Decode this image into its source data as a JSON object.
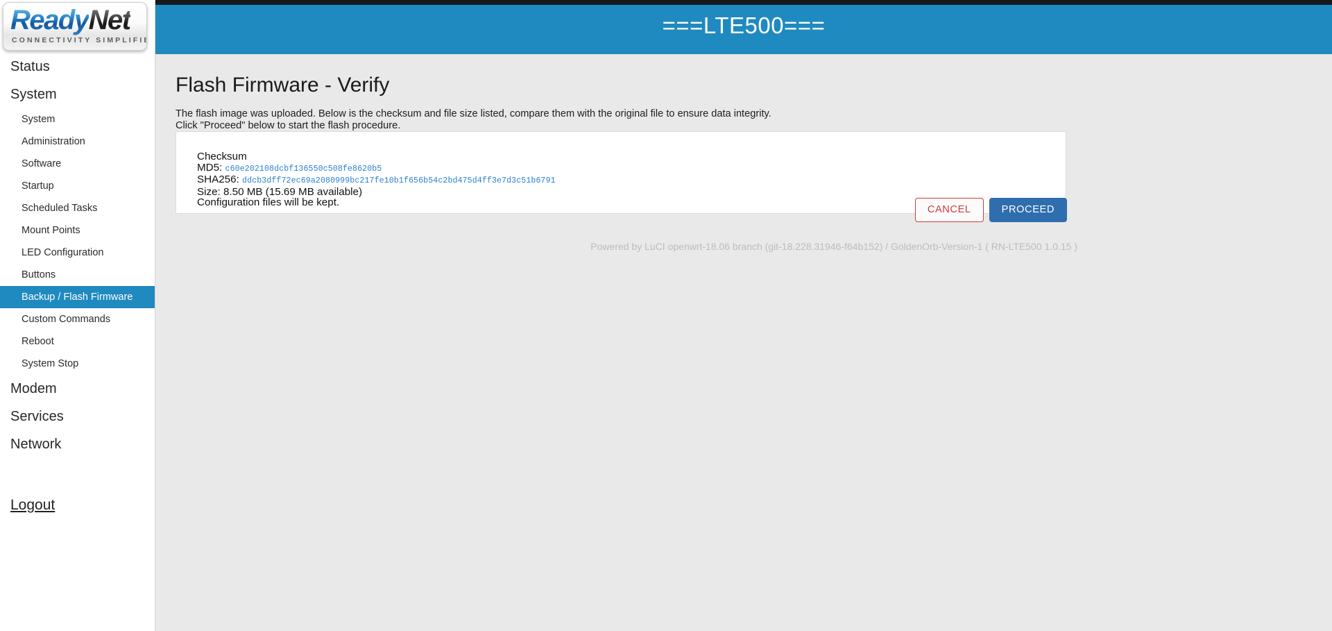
{
  "brand": {
    "logo_primary": "Ready",
    "logo_secondary": "Net",
    "logo_tagline": "CONNECTIVITY SIMPLIFIED",
    "accent_blue": "#1f8ac0",
    "proceed_blue": "#2f6eae",
    "cancel_red": "#cf3a3a",
    "hash_blue": "#2a7fd4"
  },
  "header": {
    "title": "===LTE500==="
  },
  "sidebar": {
    "items": [
      {
        "label": "Status",
        "level": "top",
        "active": false
      },
      {
        "label": "System",
        "level": "top",
        "active": false
      },
      {
        "label": "System",
        "level": "sub",
        "active": false
      },
      {
        "label": "Administration",
        "level": "sub",
        "active": false
      },
      {
        "label": "Software",
        "level": "sub",
        "active": false
      },
      {
        "label": "Startup",
        "level": "sub",
        "active": false
      },
      {
        "label": "Scheduled Tasks",
        "level": "sub",
        "active": false
      },
      {
        "label": "Mount Points",
        "level": "sub",
        "active": false
      },
      {
        "label": "LED Configuration",
        "level": "sub",
        "active": false
      },
      {
        "label": "Buttons",
        "level": "sub",
        "active": false
      },
      {
        "label": "Backup / Flash Firmware",
        "level": "sub",
        "active": true
      },
      {
        "label": "Custom Commands",
        "level": "sub",
        "active": false
      },
      {
        "label": "Reboot",
        "level": "sub",
        "active": false
      },
      {
        "label": "System Stop",
        "level": "sub",
        "active": false
      },
      {
        "label": "Modem",
        "level": "top",
        "active": false
      },
      {
        "label": "Services",
        "level": "top",
        "active": false
      },
      {
        "label": "Network",
        "level": "top",
        "active": false
      }
    ],
    "logout_label": "Logout"
  },
  "main": {
    "page_title": "Flash Firmware - Verify",
    "description_line1": "The flash image was uploaded. Below is the checksum and file size listed, compare them with the original file to ensure data integrity.",
    "description_line2": "Click \"Proceed\" below to start the flash procedure.",
    "verify": {
      "heading": "Checksum",
      "md5_label": "MD5:",
      "md5_value": "c60e202108dcbf136550c508fe8620b5",
      "sha256_label": "SHA256:",
      "sha256_value": "ddcb3dff72ec69a2080999bc217fe10b1f656b54c2bd475d4ff3e7d3c51b6791",
      "size_line": "Size: 8.50 MB (15.69 MB available)",
      "config_line": "Configuration files will be kept."
    },
    "buttons": {
      "cancel_label": "CANCEL",
      "proceed_label": "PROCEED"
    },
    "footer_text": "Powered by LuCI openwrt-18.06 branch (git-18.228.31946-f64b152) / GoldenOrb-Version-1 ( RN-LTE500 1.0.15 )"
  }
}
